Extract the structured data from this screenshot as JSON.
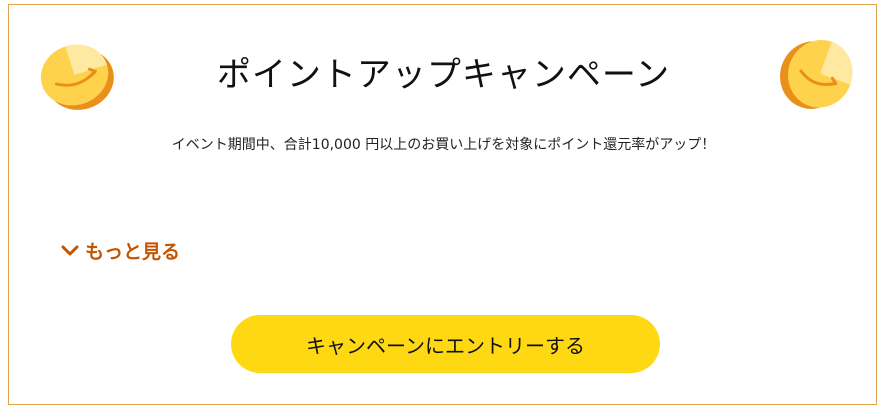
{
  "campaign": {
    "title": "ポイントアップキャンペーン",
    "description": "イベント期間中、合計10,000 円以上のお買い上げを対象にポイント還元率がアップ！",
    "more_label": "もっと見る",
    "entry_button_label": "キャンペーンにエントリーする"
  },
  "icons": {
    "left": "amazon-coin-icon",
    "right": "amazon-coin-icon",
    "more": "chevron-down-icon"
  },
  "colors": {
    "border": "#e0a24a",
    "accent_link": "#c45500",
    "button": "#ffd814",
    "coin_light": "#ffe680",
    "coin_dark": "#e8901a"
  }
}
